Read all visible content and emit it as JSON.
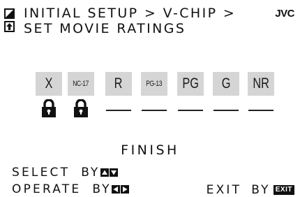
{
  "header": {
    "breadcrumb": "INITIAL SETUP > V-CHIP >",
    "title": "SET MOVIE RATINGS",
    "brand": "JVC",
    "icon": "setup-menu-icon"
  },
  "ratings": [
    {
      "label": "X",
      "locked": true
    },
    {
      "label": "NC-17",
      "locked": true
    },
    {
      "label": "R",
      "locked": false
    },
    {
      "label": "PG-13",
      "locked": false
    },
    {
      "label": "PG",
      "locked": false
    },
    {
      "label": "G",
      "locked": false
    },
    {
      "label": "NR",
      "locked": false
    }
  ],
  "finish_label": "FINISH",
  "hints": {
    "select_label": "SELECT",
    "select_by": "BY",
    "operate_label": "OPERATE",
    "operate_by": "BY",
    "exit_label": "EXIT",
    "exit_by": "BY",
    "exit_key": "EXIT"
  },
  "colors": {
    "background": "#ffffff",
    "text": "#111111",
    "chip": "#d5d5d5"
  }
}
